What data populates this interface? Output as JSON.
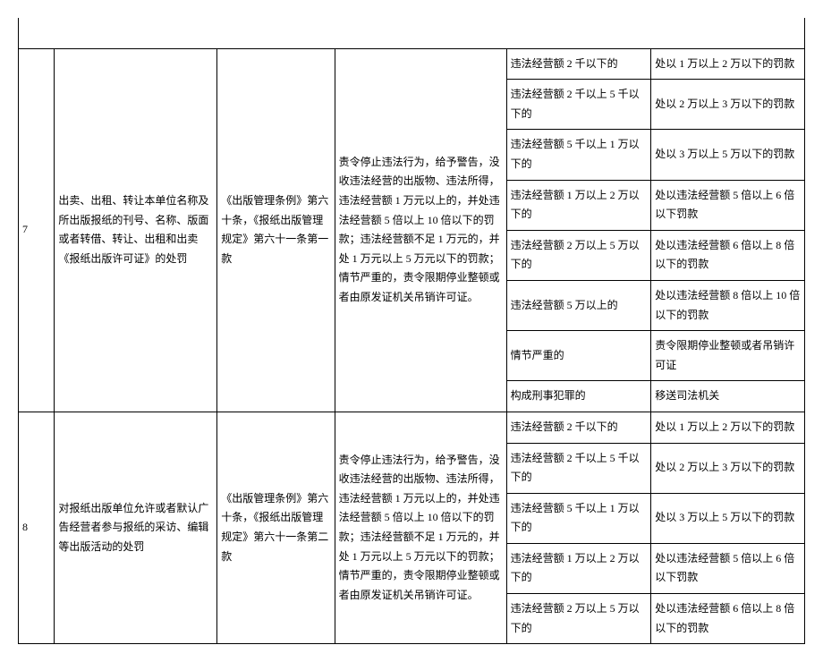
{
  "rows": [
    {
      "num": "7",
      "desc": "出卖、出租、转让本单位名称及所出版报纸的刊号、名称、版面或者转借、转让、出租和出卖《报纸出版许可证》的处罚",
      "basis": "《出版管理条例》第六十条，《报纸出版管理规定》第六十一条第一款",
      "penalty": "责令停止违法行为，给予警告，没收违法经营的出版物、违法所得，违法经营额 1 万元以上的，并处违法经营额 5 倍以上 10 倍以下的罚款；违法经营额不足 1 万元的，并处 1 万元以上 5 万元以下的罚款；情节严重的，责令限期停业整顿或者由原发证机关吊销许可证。",
      "conds": [
        {
          "c": "违法经营额 2 千以下的",
          "r": "处以 1 万以上 2 万以下的罚款"
        },
        {
          "c": "违法经营额 2 千以上 5 千以下的",
          "r": "处以 2 万以上 3 万以下的罚款"
        },
        {
          "c": "违法经营额 5 千以上 1 万以下的",
          "r": "处以 3 万以上 5 万以下的罚款"
        },
        {
          "c": "违法经营额 1 万以上 2 万以下的",
          "r": "处以违法经营额 5 倍以上 6 倍以下罚款"
        },
        {
          "c": "违法经营额 2 万以上 5 万以下的",
          "r": "处以违法经营额 6 倍以上 8 倍以下的罚款"
        },
        {
          "c": "违法经营额 5 万以上的",
          "r": "处以违法经营额 8 倍以上 10 倍以下的罚款"
        },
        {
          "c": "情节严重的",
          "r": "责令限期停业整顿或者吊销许可证"
        },
        {
          "c": "构成刑事犯罪的",
          "r": "移送司法机关"
        }
      ]
    },
    {
      "num": "8",
      "desc": "对报纸出版单位允许或者默认广告经营者参与报纸的采访、编辑等出版活动的处罚",
      "basis": "《出版管理条例》第六十条，《报纸出版管理规定》第六十一条第二款",
      "penalty": "责令停止违法行为，给予警告，没收违法经营的出版物、违法所得，违法经营额 1 万元以上的，并处违法经营额 5 倍以上 10 倍以下的罚款；违法经营额不足 1 万元的，并处 1 万元以上 5 万元以下的罚款；情节严重的，责令限期停业整顿或者由原发证机关吊销许可证。",
      "conds": [
        {
          "c": "违法经营额 2 千以下的",
          "r": "处以 1 万以上 2 万以下的罚款"
        },
        {
          "c": "违法经营额 2 千以上 5 千以下的",
          "r": "处以 2 万以上 3 万以下的罚款"
        },
        {
          "c": "违法经营额 5 千以上 1 万以下的",
          "r": "处以 3 万以上 5 万以下的罚款"
        },
        {
          "c": "违法经营额 1 万以上 2 万以下的",
          "r": "处以违法经营额 5 倍以上 6 倍以下罚款"
        },
        {
          "c": "违法经营额 2 万以上 5 万以下的",
          "r": "处以违法经营额 6 倍以上 8 倍以下的罚款"
        }
      ]
    }
  ]
}
